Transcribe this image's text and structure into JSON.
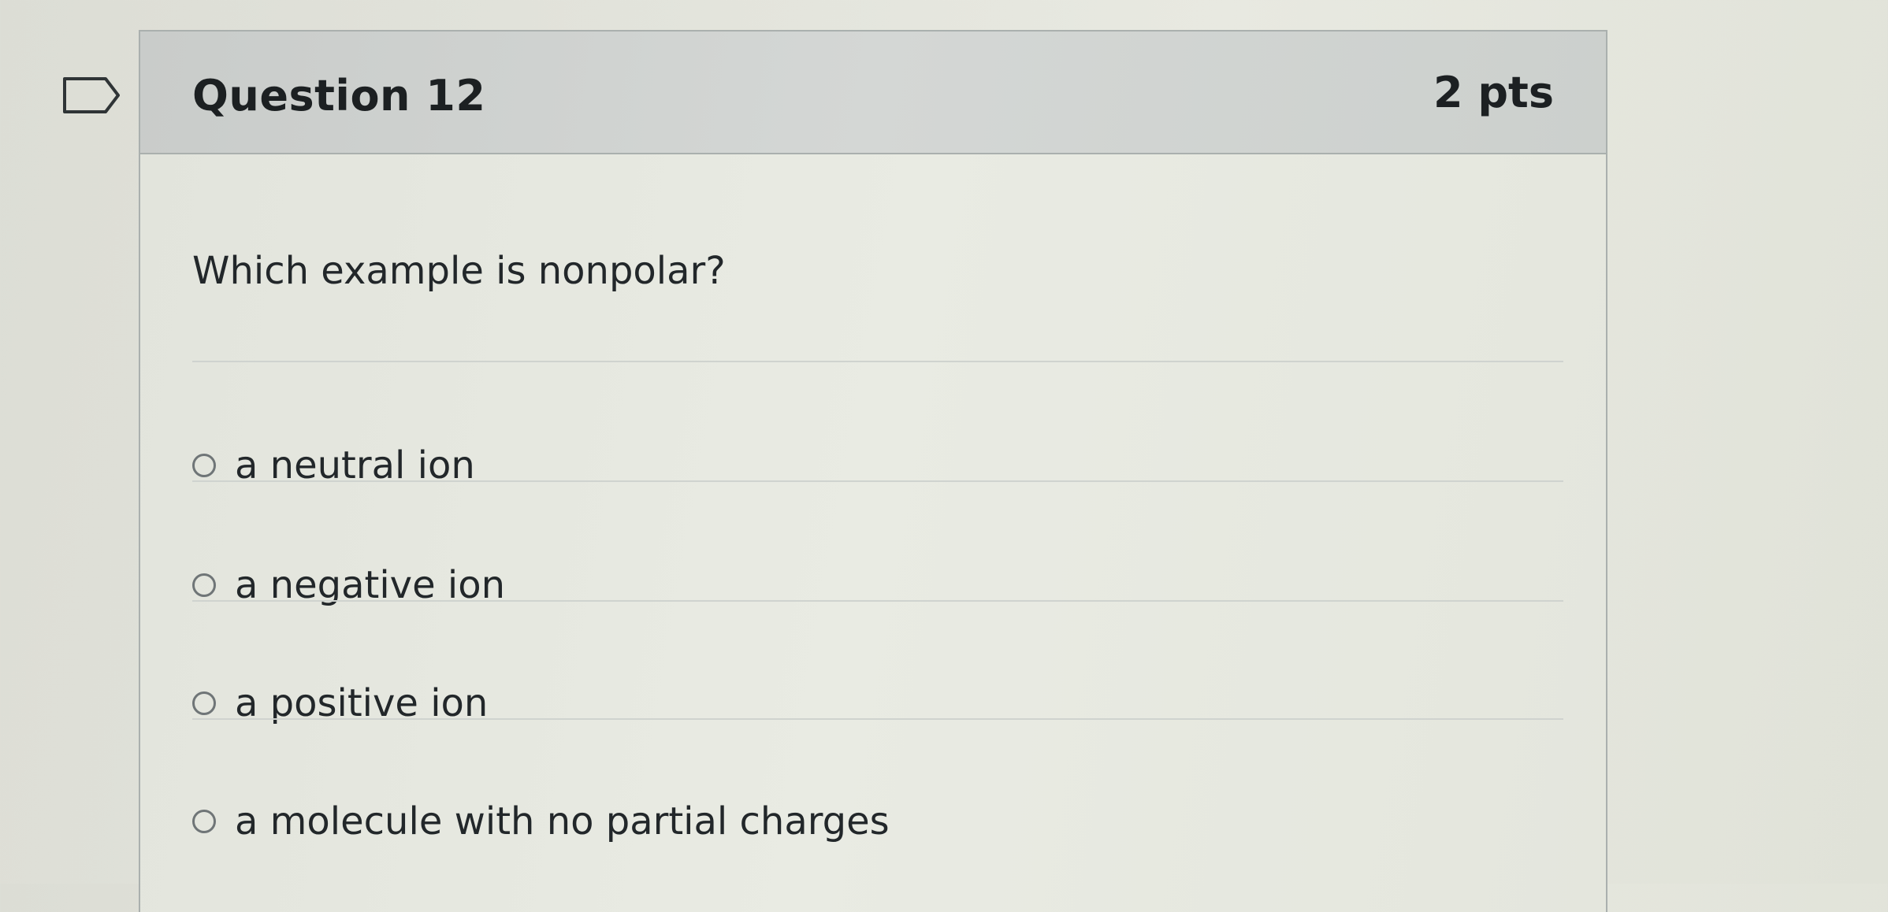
{
  "question": {
    "title": "Question 12",
    "points": "2 pts",
    "prompt": "Which example is nonpolar?",
    "flag_icon": "flag-outline-icon",
    "answers": [
      {
        "label": "a neutral ion",
        "selected": false
      },
      {
        "label": "a negative ion",
        "selected": false
      },
      {
        "label": "a positive ion",
        "selected": false
      },
      {
        "label": "a molecule with no partial charges",
        "selected": false
      }
    ]
  },
  "colors": {
    "header_bg": "#cfd2d0",
    "body_bg": "#e6e8e0",
    "border": "#aab0ae",
    "text": "#1c2022"
  }
}
